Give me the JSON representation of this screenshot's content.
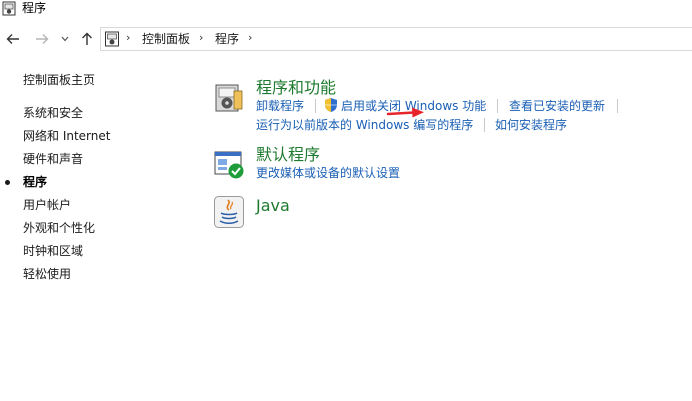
{
  "window": {
    "title": "程序"
  },
  "navigation": {
    "breadcrumb": [
      "控制面板",
      "程序"
    ]
  },
  "sidebar": {
    "home": "控制面板主页",
    "items": [
      {
        "label": "系统和安全"
      },
      {
        "label": "网络和 Internet"
      },
      {
        "label": "硬件和声音"
      },
      {
        "label": "程序",
        "active": true
      },
      {
        "label": "用户帐户"
      },
      {
        "label": "外观和个性化"
      },
      {
        "label": "时钟和区域"
      },
      {
        "label": "轻松使用"
      }
    ]
  },
  "categories": [
    {
      "title": "程序和功能",
      "icon": "programs-features-icon",
      "links": [
        "卸载程序",
        "启用或关闭 Windows 功能",
        "查看已安装的更新",
        "运行为以前版本的 Windows 编写的程序",
        "如何安装程序"
      ]
    },
    {
      "title": "默认程序",
      "icon": "default-programs-icon",
      "links": [
        "更改媒体或设备的默认设置"
      ]
    },
    {
      "title": "Java",
      "icon": "java-icon",
      "links": []
    }
  ],
  "colors": {
    "category_title": "#1e7a2f",
    "link": "#1a5fb4",
    "annotation_arrow": "#e8242b"
  }
}
